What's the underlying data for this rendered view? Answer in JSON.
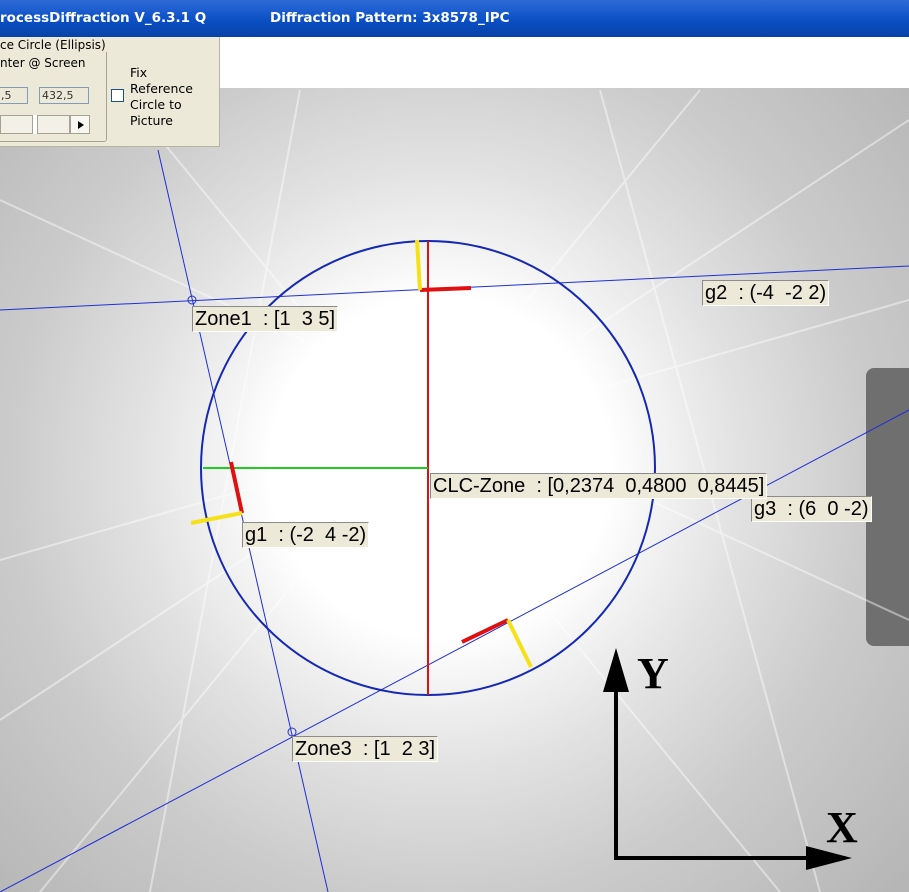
{
  "window": {
    "app_title": "rocessDiffraction V_6.3.1 Q",
    "document_title": "Diffraction Pattern: 3x8578_IPC"
  },
  "panel": {
    "group_title": "ce Circle (Ellipsis)",
    "center_label": "nter @ Screen",
    "center_x_value": ",5",
    "center_y_value": "432,5",
    "fix_checkbox_label": "Fix Reference Circle to Picture",
    "fix_checked": false
  },
  "overlay": {
    "labels": {
      "zone1": "Zone1  : [1  3 5]",
      "zone3": "Zone3  : [1  2 3]",
      "g1": "g1  : (-2  4 -2)",
      "g2": "g2  : (-4  -2 2)",
      "g3": "g3  : (6  0 -2)",
      "clc": "CLC-Zone  : [0,2374  0,4800  0,8445]"
    },
    "axis_y": "Y",
    "axis_x": "X"
  },
  "colors": {
    "reference_circle": "#1428b4",
    "zone_lines": "#1e2fd6",
    "center_vertical": "#e01010",
    "center_horizontal": "#22cc22",
    "vector_marker_red": "#e01010",
    "vector_marker_yellow": "#f5e11a"
  },
  "icons": {
    "scroll_right": "arrow-right-icon",
    "beam_stop": "beamstop-shadow"
  }
}
